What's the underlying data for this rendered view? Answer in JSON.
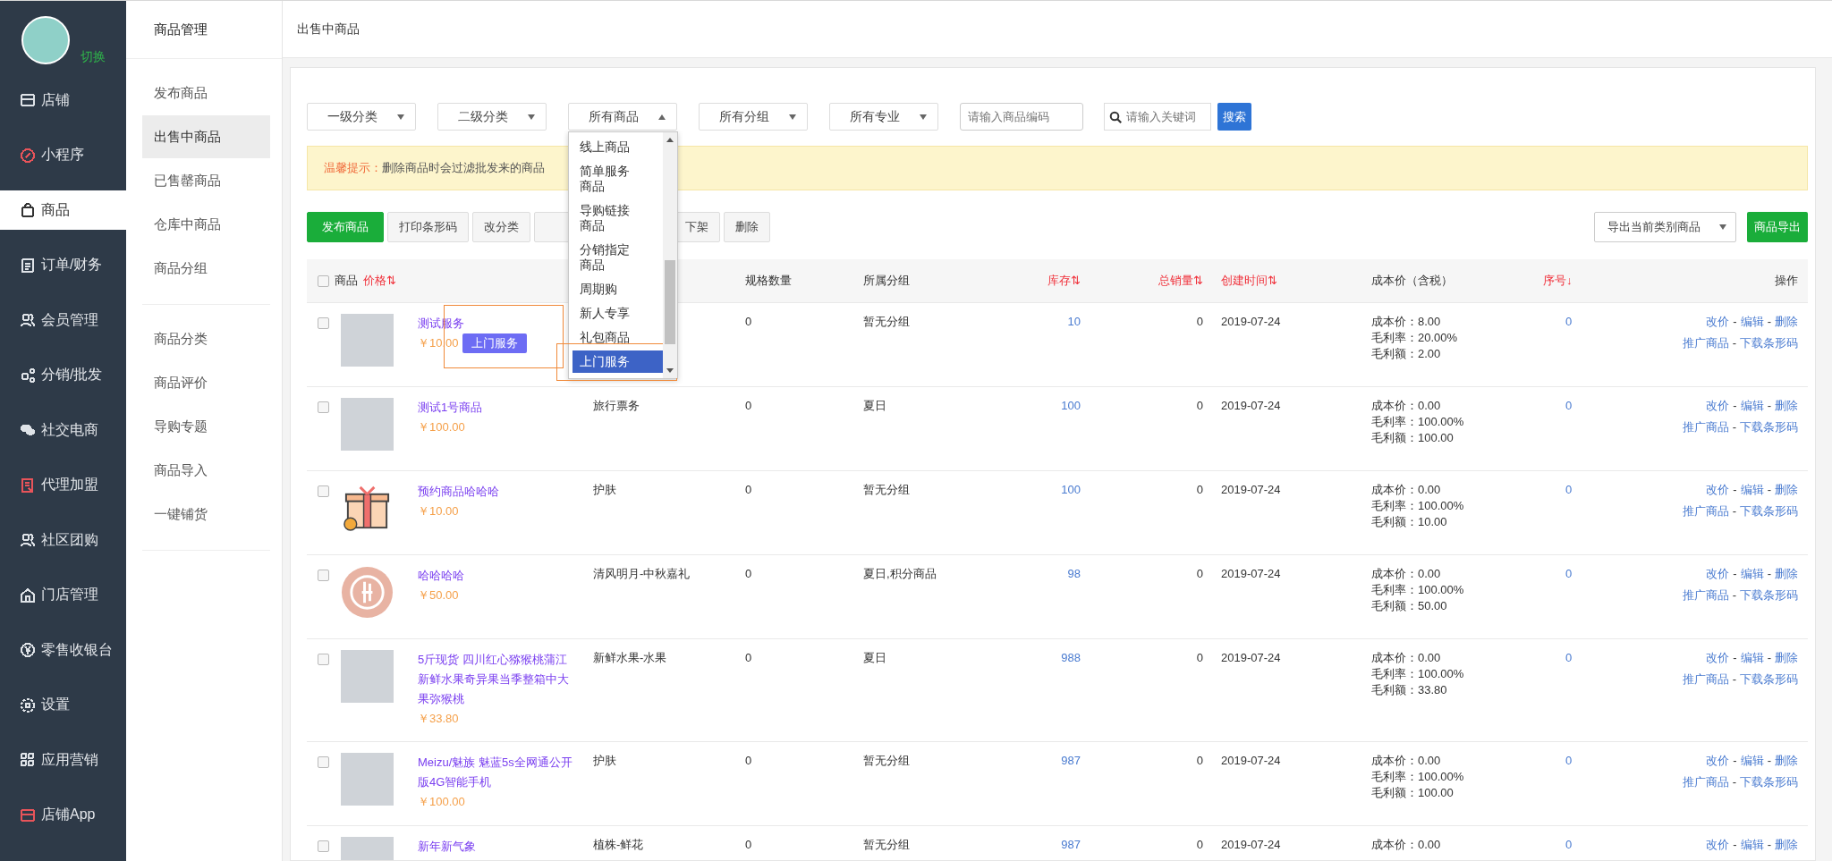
{
  "sidebar": {
    "avatar_caption": "切换",
    "items": [
      {
        "label": "店铺",
        "selected": false,
        "color": "#dfe3e8"
      },
      {
        "label": "小程序",
        "selected": false,
        "color": "#e8545a"
      },
      {
        "label": "商品",
        "selected": true,
        "color": "#333333"
      },
      {
        "label": "订单/财务",
        "selected": false,
        "color": "#dfe3e8"
      },
      {
        "label": "会员管理",
        "selected": false,
        "color": "#dfe3e8"
      },
      {
        "label": "分销/批发",
        "selected": false,
        "color": "#dfe3e8"
      },
      {
        "label": "社交电商",
        "selected": false,
        "color": "#dfe3e8"
      },
      {
        "label": "代理加盟",
        "selected": false,
        "color": "#e8545a"
      },
      {
        "label": "社区团购",
        "selected": false,
        "color": "#dfe3e8"
      },
      {
        "label": "门店管理",
        "selected": false,
        "color": "#dfe3e8"
      },
      {
        "label": "零售收银台",
        "selected": false,
        "color": "#dfe3e8"
      },
      {
        "label": "设置",
        "selected": false,
        "color": "#dfe3e8"
      },
      {
        "label": "应用营销",
        "selected": false,
        "color": "#dfe3e8"
      },
      {
        "label": "店铺App",
        "selected": false,
        "color": "#e8545a"
      }
    ]
  },
  "submenu": {
    "title": "商品管理",
    "groups": [
      [
        {
          "label": "发布商品",
          "selected": false
        },
        {
          "label": "出售中商品",
          "selected": true
        },
        {
          "label": "已售罄商品",
          "selected": false
        },
        {
          "label": "仓库中商品",
          "selected": false
        },
        {
          "label": "商品分组",
          "selected": false
        }
      ],
      [
        {
          "label": "商品分类",
          "selected": false
        },
        {
          "label": "商品评价",
          "selected": false
        },
        {
          "label": "导购专题",
          "selected": false
        },
        {
          "label": "商品导入",
          "selected": false
        },
        {
          "label": "一键铺货",
          "selected": false
        }
      ]
    ]
  },
  "page_title": "出售中商品",
  "filters": {
    "selects": [
      {
        "label": "一级分类",
        "expanded": false
      },
      {
        "label": "二级分类",
        "expanded": false
      },
      {
        "label": "所有商品",
        "expanded": true,
        "options": [
          {
            "label": "线上商品",
            "selected": false
          },
          {
            "label": "简单服务商品",
            "selected": false
          },
          {
            "label": "导购链接商品",
            "selected": false
          },
          {
            "label": "分销指定商品",
            "selected": false
          },
          {
            "label": "周期购",
            "selected": false
          },
          {
            "label": "新人专享",
            "selected": false
          },
          {
            "label": "礼包商品",
            "selected": false
          },
          {
            "label": "上门服务",
            "selected": true,
            "highlighted": true
          }
        ]
      },
      {
        "label": "所有分组",
        "expanded": false
      },
      {
        "label": "所有专业",
        "expanded": false
      }
    ],
    "code_field": {
      "placeholder": "请输入商品编码"
    },
    "keyword_field": {
      "placeholder": "请输入关键词"
    },
    "search_button": "搜索"
  },
  "notice": {
    "label": "温馨提示：",
    "text": "删除商品时会过滤批发来的商品"
  },
  "toolbar": {
    "buttons": [
      {
        "label": "发布商品",
        "kind": "primary"
      },
      {
        "label": "打印条形码",
        "kind": "default"
      },
      {
        "label": "改分类",
        "kind": "default"
      },
      {
        "kind": "covered"
      },
      {
        "label": "下架",
        "kind": "default"
      },
      {
        "label": "删除",
        "kind": "default"
      }
    ],
    "export_select": "导出当前类别商品",
    "export_button": "商品导出"
  },
  "table": {
    "action_separator": "-",
    "columns": [
      {
        "kind": "product",
        "label": "商品",
        "checked": false,
        "sort_label": "价格",
        "sort_mark": "⇅"
      },
      {
        "kind": "covered"
      },
      {
        "kind": "plain",
        "label": "规格数量"
      },
      {
        "kind": "plain",
        "label": "所属分组"
      },
      {
        "kind": "sort",
        "label": "库存",
        "sort_mark": "⇅"
      },
      {
        "kind": "sort",
        "label": "总销量",
        "sort_mark": "⇅"
      },
      {
        "kind": "sort",
        "label": "创建时间",
        "sort_mark": "⇅"
      },
      {
        "kind": "plain",
        "label": "成本价（含税）"
      },
      {
        "kind": "sort",
        "label": "序号",
        "sort_mark": "↓"
      },
      {
        "kind": "plain",
        "label": "操作"
      }
    ],
    "rows": [
      {
        "checked": false,
        "image": {
          "kind": "photo"
        },
        "name": "测试服务",
        "price": "￥10.00",
        "tag": {
          "label": "上门服务",
          "highlighted": true
        },
        "spec": "0",
        "group": "暂无分组",
        "stock": "10",
        "sales": "0",
        "created": "2019-07-24",
        "cost_lines": [
          "成本价：8.00",
          "毛利率：20.00%",
          "毛利额：2.00"
        ],
        "seq": "0",
        "actions": [
          [
            "改价",
            "编辑",
            "删除"
          ],
          [
            "推广商品",
            "下载条形码"
          ]
        ]
      },
      {
        "checked": false,
        "image": {
          "kind": "photo"
        },
        "name": "测试1号商品",
        "price": "￥100.00",
        "category": "旅行票务",
        "spec": "0",
        "group": "夏日",
        "stock": "100",
        "sales": "0",
        "created": "2019-07-24",
        "cost_lines": [
          "成本价：0.00",
          "毛利率：100.00%",
          "毛利额：100.00"
        ],
        "seq": "0",
        "actions": [
          [
            "改价",
            "编辑",
            "删除"
          ],
          [
            "推广商品",
            "下载条形码"
          ]
        ]
      },
      {
        "checked": false,
        "image": {
          "kind": "gift"
        },
        "name": "预约商品哈哈哈",
        "price": "￥10.00",
        "category": "护肤",
        "spec": "0",
        "group": "暂无分组",
        "stock": "100",
        "sales": "0",
        "created": "2019-07-24",
        "cost_lines": [
          "成本价：0.00",
          "毛利率：100.00%",
          "毛利额：10.00"
        ],
        "seq": "0",
        "actions": [
          [
            "改价",
            "编辑",
            "删除"
          ],
          [
            "推广商品",
            "下载条形码"
          ]
        ]
      },
      {
        "checked": false,
        "image": {
          "kind": "logo"
        },
        "name": "哈哈哈哈",
        "price": "￥50.00",
        "category": "清风明月-中秋嘉礼",
        "spec": "0",
        "group": "夏日,积分商品",
        "stock": "98",
        "sales": "0",
        "created": "2019-07-24",
        "cost_lines": [
          "成本价：0.00",
          "毛利率：100.00%",
          "毛利额：50.00"
        ],
        "seq": "0",
        "actions": [
          [
            "改价",
            "编辑",
            "删除"
          ],
          [
            "推广商品",
            "下载条形码"
          ]
        ]
      },
      {
        "checked": false,
        "image": {
          "kind": "photo"
        },
        "name": "5斤现货 四川红心猕猴桃蒲江新鲜水果奇异果当季整箱中大果弥猴桃",
        "price": "￥33.80",
        "category": "新鲜水果-水果",
        "spec": "0",
        "group": "夏日",
        "stock": "988",
        "sales": "0",
        "created": "2019-07-24",
        "cost_lines": [
          "成本价：0.00",
          "毛利率：100.00%",
          "毛利额：33.80"
        ],
        "seq": "0",
        "actions": [
          [
            "改价",
            "编辑",
            "删除"
          ],
          [
            "推广商品",
            "下载条形码"
          ]
        ]
      },
      {
        "checked": false,
        "image": {
          "kind": "photo"
        },
        "name": "Meizu/魅族 魅蓝5s全网通公开版4G智能手机",
        "price": "￥100.00",
        "category": "护肤",
        "spec": "0",
        "group": "暂无分组",
        "stock": "987",
        "sales": "0",
        "created": "2019-07-24",
        "cost_lines": [
          "成本价：0.00",
          "毛利率：100.00%",
          "毛利额：100.00"
        ],
        "seq": "0",
        "actions": [
          [
            "改价",
            "编辑",
            "删除"
          ],
          [
            "推广商品",
            "下载条形码"
          ]
        ]
      },
      {
        "checked": false,
        "image": {
          "kind": "photo"
        },
        "name": "新年新气象",
        "category": "植株-鲜花",
        "spec": "0",
        "group": "暂无分组",
        "stock": "987",
        "sales": "0",
        "created": "2019-07-24",
        "cost_lines": [
          "成本价：0.00"
        ],
        "seq": "0",
        "actions": [
          [
            "改价",
            "编辑",
            "删除"
          ]
        ]
      }
    ]
  }
}
